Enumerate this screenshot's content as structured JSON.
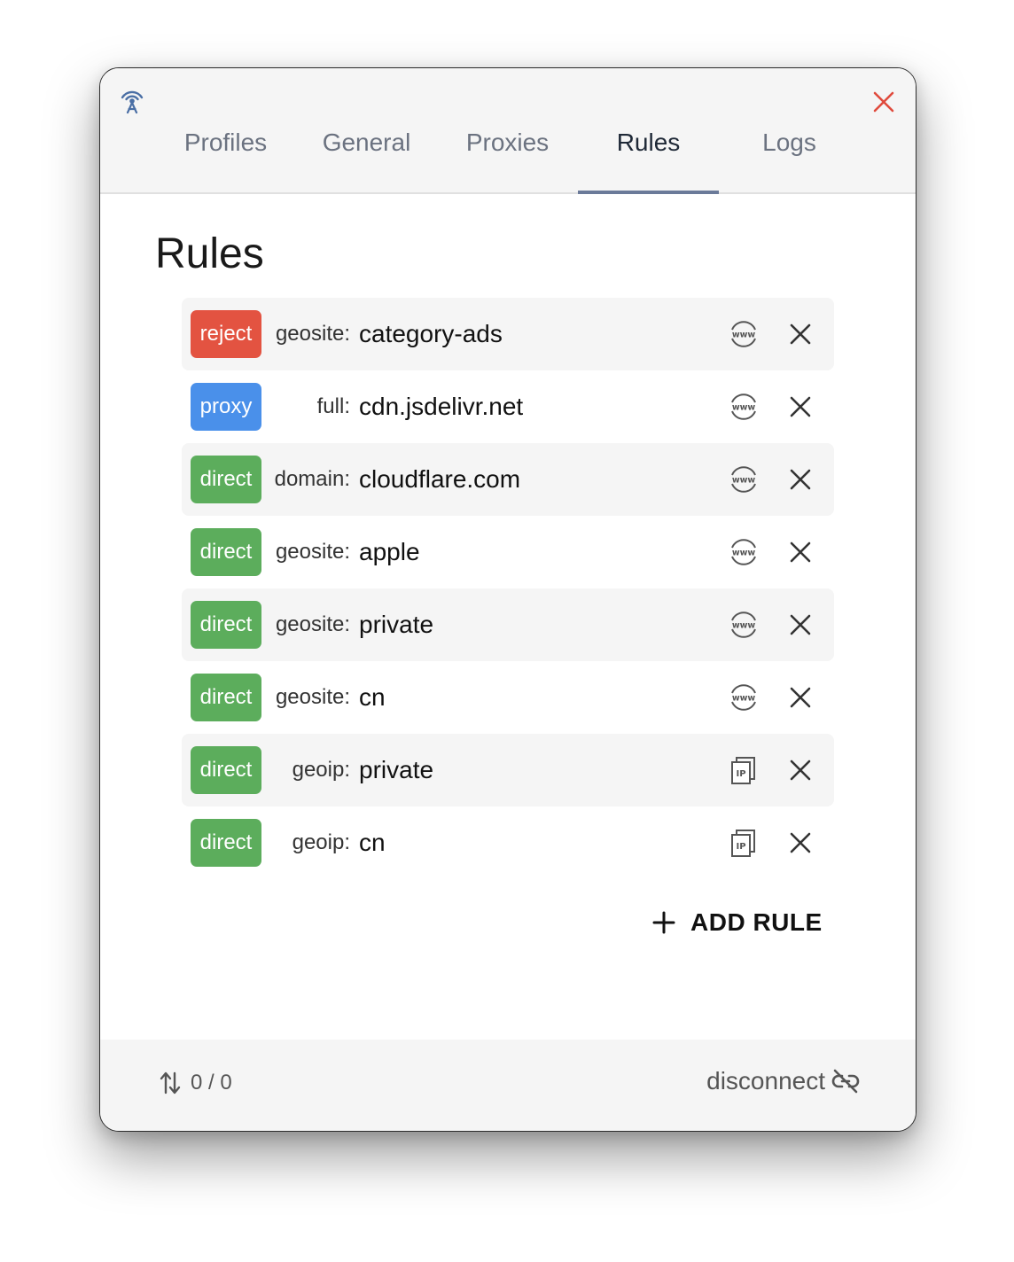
{
  "window": {
    "close_icon": "close-icon",
    "app_icon": "antenna-icon"
  },
  "tabs": [
    {
      "label": "Profiles",
      "active": false
    },
    {
      "label": "General",
      "active": false
    },
    {
      "label": "Proxies",
      "active": false
    },
    {
      "label": "Rules",
      "active": true
    },
    {
      "label": "Logs",
      "active": false
    }
  ],
  "page": {
    "title": "Rules"
  },
  "colors": {
    "reject": "#e35341",
    "proxy": "#4a90ea",
    "direct": "#5cad5c",
    "close": "#e04a3c",
    "tab_indicator": "#6b7a99"
  },
  "rules": [
    {
      "action": "reject",
      "type": "geosite:",
      "value": "category-ads",
      "icon": "www-globe-icon"
    },
    {
      "action": "proxy",
      "type": "full:",
      "value": "cdn.jsdelivr.net",
      "icon": "www-globe-icon"
    },
    {
      "action": "direct",
      "type": "domain:",
      "value": "cloudflare.com",
      "icon": "www-globe-icon"
    },
    {
      "action": "direct",
      "type": "geosite:",
      "value": "apple",
      "icon": "www-globe-icon"
    },
    {
      "action": "direct",
      "type": "geosite:",
      "value": "private",
      "icon": "www-globe-icon"
    },
    {
      "action": "direct",
      "type": "geosite:",
      "value": "cn",
      "icon": "www-globe-icon"
    },
    {
      "action": "direct",
      "type": "geoip:",
      "value": "private",
      "icon": "ip-icon"
    },
    {
      "action": "direct",
      "type": "geoip:",
      "value": "cn",
      "icon": "ip-icon"
    }
  ],
  "add_rule": {
    "label": "ADD RULE",
    "icon": "plus-icon"
  },
  "footer": {
    "traffic": "0 / 0",
    "traffic_icon": "up-down-arrows-icon",
    "disconnect_label": "disconnect",
    "disconnect_icon": "link-off-icon"
  }
}
